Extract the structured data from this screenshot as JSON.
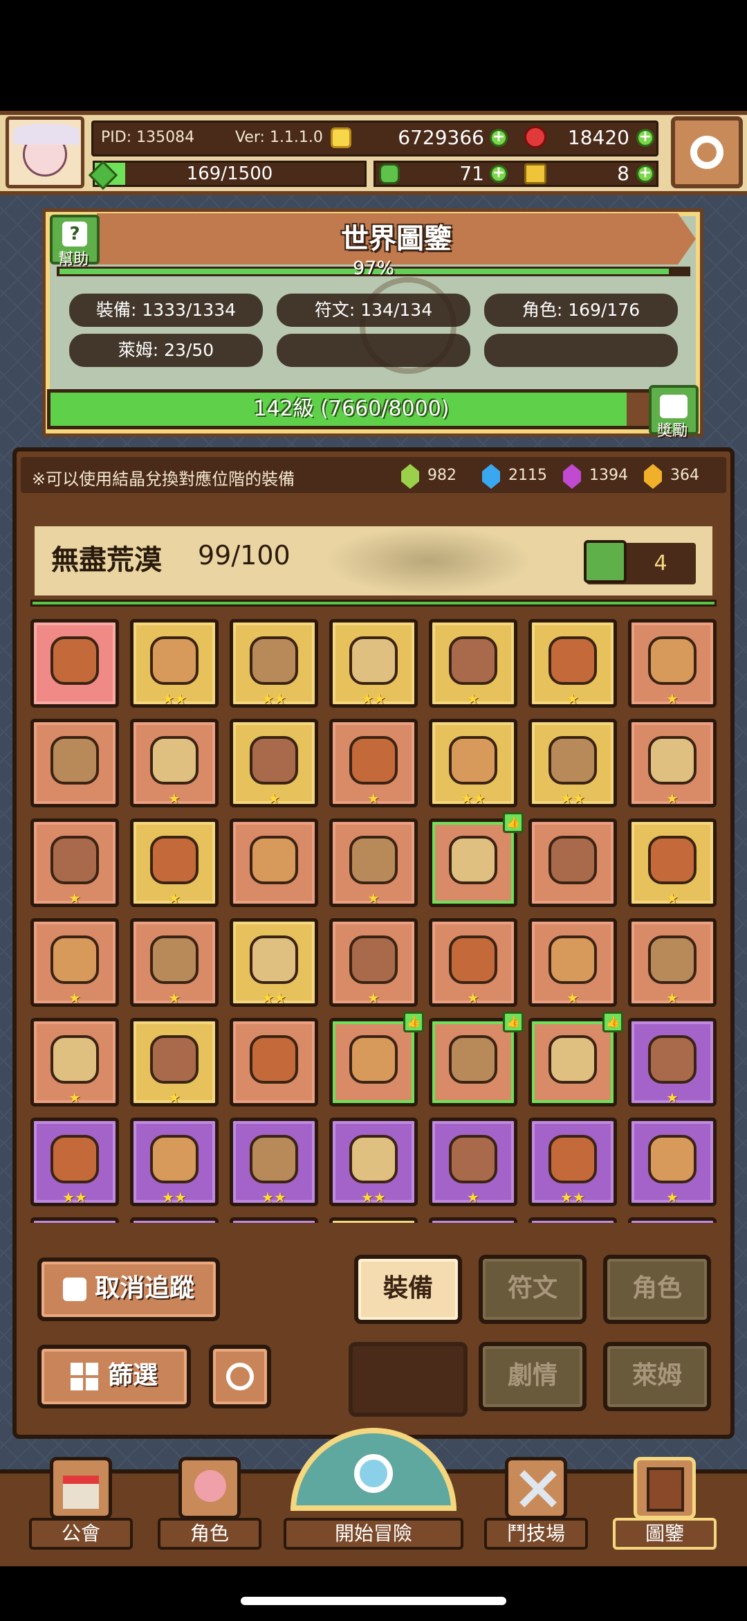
{
  "header": {
    "pid": "PID: 135084",
    "version": "Ver: 1.1.1.0",
    "gold": "6729366",
    "rubies": "18420",
    "exp": "169/1500",
    "clovers": "71",
    "keys": "8",
    "exp_fraction": 0.113
  },
  "atlas": {
    "title": "世界圖鑒",
    "help_label": "幫助",
    "percent": "97%",
    "percent_value": 0.97,
    "stats": {
      "equipment": "裝備: 1333/1334",
      "runes": "符文: 134/134",
      "characters": "角色: 169/176",
      "slimes": "萊姆: 23/50"
    },
    "level_text": "142級 (7660/8000)",
    "level_fraction": 0.9575,
    "reward_label": "獎勵"
  },
  "notice": {
    "text": "※可以使用結晶兌換對應位階的裝備",
    "crystals": [
      {
        "color": "#9bd04a",
        "count": "982"
      },
      {
        "color": "#3aa8f0",
        "count": "2115"
      },
      {
        "color": "#c04ad0",
        "count": "1394"
      },
      {
        "color": "#f0b02a",
        "count": "364"
      }
    ]
  },
  "region": {
    "name": "無盡荒漠",
    "progress": "99/100",
    "likes": "4",
    "progress_fraction": 1.0
  },
  "grid": {
    "rows": [
      [
        {
          "c": "pinkred",
          "s": 0
        },
        {
          "c": "gold",
          "s": 2
        },
        {
          "c": "gold",
          "s": 2
        },
        {
          "c": "gold",
          "s": 2
        },
        {
          "c": "gold",
          "s": 1
        },
        {
          "c": "gold",
          "s": 1
        },
        {
          "c": "red",
          "s": 1
        }
      ],
      [
        {
          "c": "red",
          "s": 0
        },
        {
          "c": "red",
          "s": 1
        },
        {
          "c": "gold",
          "s": 1
        },
        {
          "c": "red",
          "s": 1
        },
        {
          "c": "gold",
          "s": 2
        },
        {
          "c": "gold",
          "s": 2
        },
        {
          "c": "red",
          "s": 1
        }
      ],
      [
        {
          "c": "red",
          "s": 1
        },
        {
          "c": "gold",
          "s": 1
        },
        {
          "c": "red",
          "s": 0
        },
        {
          "c": "red",
          "s": 1
        },
        {
          "c": "red",
          "s": 0,
          "g": 1,
          "t": 1
        },
        {
          "c": "red",
          "s": 0
        },
        {
          "c": "gold",
          "s": 1
        }
      ],
      [
        {
          "c": "red",
          "s": 1
        },
        {
          "c": "red",
          "s": 1
        },
        {
          "c": "gold",
          "s": 2
        },
        {
          "c": "red",
          "s": 1
        },
        {
          "c": "red",
          "s": 1
        },
        {
          "c": "red",
          "s": 1
        },
        {
          "c": "red",
          "s": 1
        }
      ],
      [
        {
          "c": "red",
          "s": 1
        },
        {
          "c": "gold",
          "s": 1
        },
        {
          "c": "red",
          "s": 0
        },
        {
          "c": "red",
          "s": 0,
          "g": 1,
          "t": 1
        },
        {
          "c": "red",
          "s": 0,
          "g": 1,
          "t": 1
        },
        {
          "c": "red",
          "s": 0,
          "g": 1,
          "t": 1
        },
        {
          "c": "purple",
          "s": 1
        }
      ],
      [
        {
          "c": "purple",
          "s": 2
        },
        {
          "c": "purple",
          "s": 2
        },
        {
          "c": "purple",
          "s": 2
        },
        {
          "c": "purple",
          "s": 2
        },
        {
          "c": "purple",
          "s": 1
        },
        {
          "c": "purple",
          "s": 2
        },
        {
          "c": "purple",
          "s": 1
        }
      ]
    ]
  },
  "buttons": {
    "untrack": "取消追蹤",
    "filter": "篩選",
    "equipment": "裝備",
    "runes": "符文",
    "characters": "角色",
    "story": "劇情",
    "slimes": "萊姆"
  },
  "nav": {
    "guild": "公會",
    "character": "角色",
    "adventure": "開始冒險",
    "arena": "鬥技場",
    "atlas": "圖鑒"
  }
}
